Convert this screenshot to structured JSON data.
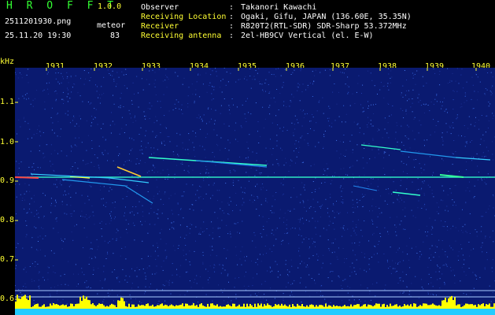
{
  "header": {
    "app_title": "H R O F F T",
    "version": "1.0.0",
    "file_name": "2511201930.png",
    "datetime": "25.11.20 19:30",
    "mode": "meteor",
    "count": "83"
  },
  "info": [
    {
      "label": "Observer",
      "value": "Takanori Kawachi"
    },
    {
      "label": "Receiving Location",
      "value": "Ogaki, Gifu, JAPAN (136.60E, 35.35N)"
    },
    {
      "label": "Receiver",
      "value": "R820T2(RTL-SDR) SDR-Sharp 53.372MHz"
    },
    {
      "label": "Receiving antenna",
      "value": "2el-HB9CV Vertical (el. E-W)"
    }
  ],
  "axis": {
    "unit": "kHz",
    "x_ticks": [
      "1931",
      "1932",
      "1933",
      "1934",
      "1935",
      "1936",
      "1937",
      "1938",
      "1939",
      "1940"
    ],
    "y_ticks": [
      "1.1",
      "1.0",
      "0.9",
      "0.8",
      "0.7",
      "0.6"
    ]
  },
  "colors": {
    "background": "#000000",
    "spectrogram_bg": "#0a1a70",
    "label_yellow": "#ffff33",
    "text_white": "#ffffff",
    "accent_green": "#33ff33",
    "echo_cyan": "#33ffcc",
    "signal_bar": "#ffff00",
    "noise_floor": "#22ccff"
  }
}
